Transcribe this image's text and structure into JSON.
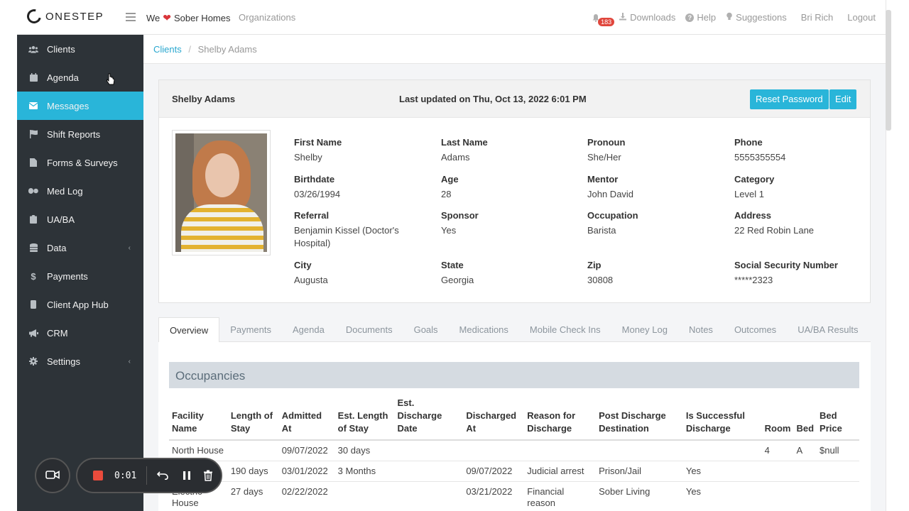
{
  "topbar": {
    "logo_text": "ONESTEP",
    "org_prefix": "We",
    "org_suffix": "Sober Homes",
    "organizations_link": "Organizations",
    "notification_count": "183",
    "downloads": "Downloads",
    "help": "Help",
    "suggestions": "Suggestions",
    "user": "Bri Rich",
    "logout": "Logout"
  },
  "sidebar": {
    "items": [
      {
        "label": "Clients",
        "icon": "users-icon"
      },
      {
        "label": "Agenda",
        "icon": "calendar-icon"
      },
      {
        "label": "Messages",
        "icon": "envelope-icon",
        "active": true
      },
      {
        "label": "Shift Reports",
        "icon": "flag-icon"
      },
      {
        "label": "Forms & Surveys",
        "icon": "file-icon"
      },
      {
        "label": "Med Log",
        "icon": "pills-icon"
      },
      {
        "label": "UA/BA",
        "icon": "clipboard-icon"
      },
      {
        "label": "Data",
        "icon": "database-icon",
        "has_submenu": true
      },
      {
        "label": "Payments",
        "icon": "dollar-icon"
      },
      {
        "label": "Client App Hub",
        "icon": "mobile-icon"
      },
      {
        "label": "CRM",
        "icon": "megaphone-icon"
      },
      {
        "label": "Settings",
        "icon": "gear-icon",
        "has_submenu": true
      }
    ],
    "active_color": "#29b5d9",
    "background_color": "#2d3338"
  },
  "breadcrumb": {
    "parent": "Clients",
    "separator": "/",
    "current": "Shelby Adams"
  },
  "client": {
    "name": "Shelby Adams",
    "last_updated": "Last updated on Thu, Oct 13, 2022 6:01 PM",
    "reset_password_label": "Reset Password",
    "edit_label": "Edit",
    "fields": {
      "first_name": {
        "label": "First Name",
        "value": "Shelby"
      },
      "last_name": {
        "label": "Last Name",
        "value": "Adams"
      },
      "pronoun": {
        "label": "Pronoun",
        "value": "She/Her"
      },
      "phone": {
        "label": "Phone",
        "value": "5555355554"
      },
      "birthdate": {
        "label": "Birthdate",
        "value": "03/26/1994"
      },
      "age": {
        "label": "Age",
        "value": "28"
      },
      "mentor": {
        "label": "Mentor",
        "value": "John David"
      },
      "category": {
        "label": "Category",
        "value": "Level 1"
      },
      "referral": {
        "label": "Referral",
        "value": "Benjamin Kissel (Doctor's Hospital)"
      },
      "sponsor": {
        "label": "Sponsor",
        "value": "Yes"
      },
      "occupation": {
        "label": "Occupation",
        "value": "Barista"
      },
      "address": {
        "label": "Address",
        "value": "22 Red Robin Lane"
      },
      "city": {
        "label": "City",
        "value": "Augusta"
      },
      "state": {
        "label": "State",
        "value": "Georgia"
      },
      "zip": {
        "label": "Zip",
        "value": "30808"
      },
      "ssn": {
        "label": "Social Security Number",
        "value": "*****2323"
      }
    }
  },
  "tabs": [
    {
      "label": "Overview",
      "active": true
    },
    {
      "label": "Payments"
    },
    {
      "label": "Agenda"
    },
    {
      "label": "Documents"
    },
    {
      "label": "Goals"
    },
    {
      "label": "Medications"
    },
    {
      "label": "Mobile Check Ins"
    },
    {
      "label": "Money Log"
    },
    {
      "label": "Notes"
    },
    {
      "label": "Outcomes"
    },
    {
      "label": "UA/BA Results"
    }
  ],
  "occupancies": {
    "title": "Occupancies",
    "columns": [
      "Facility Name",
      "Length of Stay",
      "Admitted At",
      "Est. Length of Stay",
      "Est. Discharge Date",
      "Discharged At",
      "Reason for Discharge",
      "Post Discharge Destination",
      "Is Successful Discharge",
      "Room",
      "Bed",
      "Bed Price"
    ],
    "rows": [
      [
        "North House",
        "",
        "09/07/2022",
        "30 days",
        "",
        "",
        "",
        "",
        "",
        "4",
        "A",
        "$null"
      ],
      [
        "",
        "190 days",
        "03/01/2022",
        "3 Months",
        "",
        "09/07/2022",
        "Judicial arrest",
        "Prison/Jail",
        "Yes",
        "",
        "",
        ""
      ],
      [
        "Electric House",
        "27 days",
        "02/22/2022",
        "",
        "",
        "03/21/2022",
        "Financial reason",
        "Sober Living",
        "Yes",
        "",
        "",
        ""
      ]
    ]
  },
  "recorder": {
    "time": "0:01",
    "stop_color": "#ea4b3c"
  }
}
